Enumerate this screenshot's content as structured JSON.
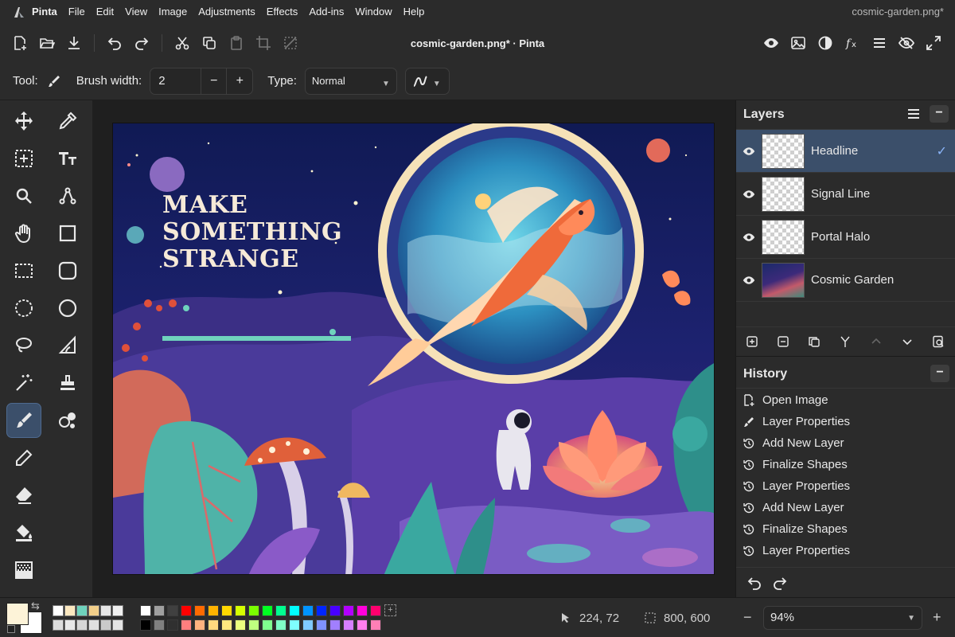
{
  "menubar": {
    "items": [
      "Pinta",
      "File",
      "Edit",
      "View",
      "Image",
      "Adjustments",
      "Effects",
      "Add-ins",
      "Window",
      "Help"
    ],
    "window_title": "cosmic-garden.png*"
  },
  "toolbar": {
    "document_title": "cosmic-garden.png* · Pinta"
  },
  "tool_options": {
    "tool_label": "Tool:",
    "brush_width_label": "Brush width:",
    "brush_width_value": "2",
    "minus": "−",
    "plus": "+",
    "type_label": "Type:",
    "type_value": "Normal"
  },
  "artwork": {
    "headline_lines": [
      "MAKE",
      "SOMETHING",
      "STRANGE"
    ]
  },
  "layers": {
    "title": "Layers",
    "items": [
      {
        "name": "Headline",
        "selected": true
      },
      {
        "name": "Signal Line",
        "selected": false
      },
      {
        "name": "Portal Halo",
        "selected": false
      },
      {
        "name": "Cosmic Garden",
        "selected": false
      }
    ]
  },
  "history": {
    "title": "History",
    "items": [
      {
        "label": "Open Image",
        "icon": "open-image-icon"
      },
      {
        "label": "Layer Properties",
        "icon": "brush-icon"
      },
      {
        "label": "Add New Layer",
        "icon": "history-icon"
      },
      {
        "label": "Finalize Shapes",
        "icon": "history-icon"
      },
      {
        "label": "Layer Properties",
        "icon": "history-icon"
      },
      {
        "label": "Add New Layer",
        "icon": "history-icon"
      },
      {
        "label": "Finalize Shapes",
        "icon": "history-icon"
      },
      {
        "label": "Layer Properties",
        "icon": "history-icon"
      }
    ]
  },
  "status": {
    "cursor_position": "224, 72",
    "selection_size": "800, 600",
    "zoom": "94%",
    "zoom_minus": "−",
    "zoom_plus": "+"
  },
  "palette": {
    "primary_color": "#fdf3d8",
    "secondary_color": "#ffffff",
    "recent_colors": [
      "#ffffff",
      "#fbe8c0",
      "#6fd3bd",
      "#f2cf8a",
      "#e6e6e6",
      "#f0f0f0",
      "#dcdcdc",
      "#e8e8e8",
      "#d6d6d6",
      "#e0e0e0",
      "#cacaca",
      "#e4e4e4"
    ],
    "row1": [
      "#ffffff",
      "#a0a0a0",
      "#404040",
      "#ff0000",
      "#ff6a00",
      "#ffb300",
      "#ffd800",
      "#d5ff00",
      "#7bff00",
      "#00ff21",
      "#00ff90",
      "#00ffff",
      "#0094ff",
      "#0026ff",
      "#4800ff",
      "#b200ff",
      "#ff00dc",
      "#ff006e"
    ],
    "row2": [
      "#000000",
      "#808080",
      "#303030",
      "#ff7f7f",
      "#ffb27f",
      "#ffd97f",
      "#ffe97f",
      "#ebff7f",
      "#bfff7f",
      "#7fff8e",
      "#7fffc5",
      "#7fffff",
      "#7fc9ff",
      "#7f92ff",
      "#a17fff",
      "#d67fff",
      "#ff7fed",
      "#ff7fb6"
    ]
  }
}
